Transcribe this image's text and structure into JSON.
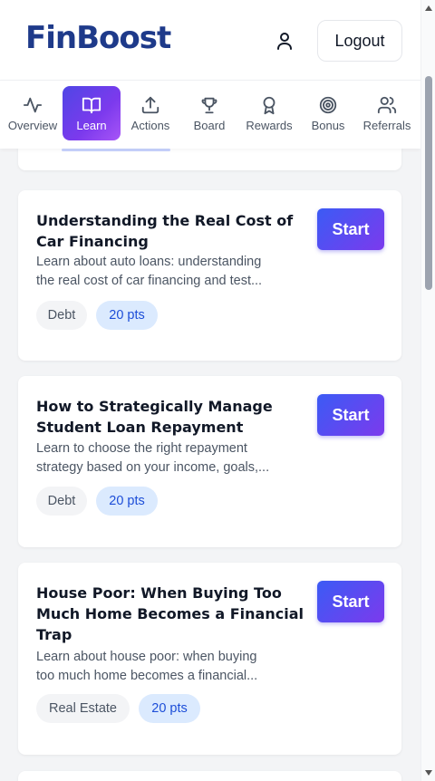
{
  "header": {
    "logo": "FinBoost",
    "logout_label": "Logout"
  },
  "nav": {
    "items": [
      {
        "label": "Overview",
        "icon": "activity-icon"
      },
      {
        "label": "Learn",
        "icon": "book-icon",
        "active": true
      },
      {
        "label": "Actions",
        "icon": "upload-icon"
      },
      {
        "label": "Board",
        "icon": "trophy-icon"
      },
      {
        "label": "Rewards",
        "icon": "award-icon"
      },
      {
        "label": "Bonus",
        "icon": "target-icon"
      },
      {
        "label": "Referrals",
        "icon": "users-icon"
      }
    ]
  },
  "modules": [
    {
      "title": "Understanding the Real Cost of Car Financing",
      "description_line1": "Learn about auto loans: understanding",
      "description_line2": "the real cost of car financing and test...",
      "category": "Debt",
      "points": "20 pts",
      "start_label": "Start"
    },
    {
      "title": "How to Strategically Manage Student Loan Repayment",
      "description_line1": "Learn to choose the right repayment",
      "description_line2": "strategy based on your income, goals,...",
      "category": "Debt",
      "points": "20 pts",
      "start_label": "Start"
    },
    {
      "title": "House Poor: When Buying Too Much Home Becomes a Financial Trap",
      "description_line1": "Learn about house poor: when buying",
      "description_line2": "too much home becomes a financial...",
      "category": "Real Estate",
      "points": "20 pts",
      "start_label": "Start"
    }
  ],
  "colors": {
    "brand": "#1e3a8a",
    "accent_start": "#3b5bf5",
    "accent_end": "#7c3aed",
    "points_bg": "#dbeafe",
    "points_text": "#1d4ed8"
  }
}
